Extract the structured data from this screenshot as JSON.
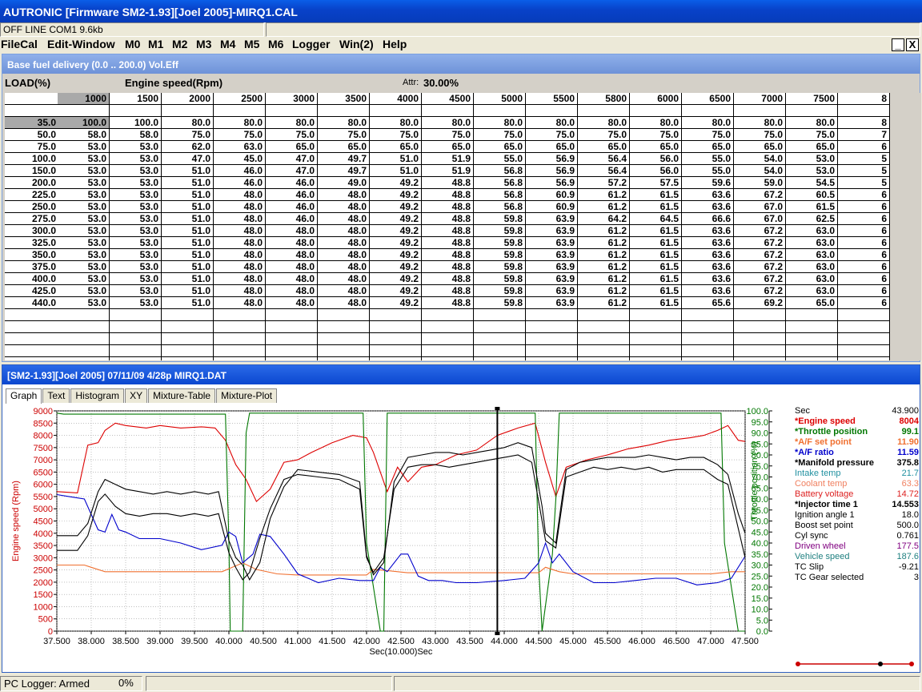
{
  "window": {
    "title": "AUTRONIC [Firmware SM2-1.93][Joel 2005]-MIRQ1.CAL"
  },
  "status_top": {
    "connection": "OFF LINE COM1 9.6kb"
  },
  "menu": [
    "FileCal",
    "Edit-Window",
    "M0",
    "M1",
    "M2",
    "M3",
    "M4",
    "M5",
    "M6",
    "Logger",
    "Win(2)",
    "Help"
  ],
  "mdi_buttons": {
    "minimize": "_",
    "close": "X"
  },
  "fuel_table": {
    "title": "Base fuel delivery (0.0 .. 200.0) Vol.Eff",
    "load_label": "LOAD(%)",
    "rpm_label": "Engine speed(Rpm)",
    "attr": "Attr:",
    "attr_value": "30.00%",
    "rpm": [
      "1000",
      "1500",
      "2000",
      "2500",
      "3000",
      "3500",
      "4000",
      "4500",
      "5000",
      "5500",
      "5800",
      "6000",
      "6500",
      "7000",
      "7500",
      "8"
    ],
    "loads": [
      "35.0",
      "50.0",
      "75.0",
      "100.0",
      "150.0",
      "200.0",
      "225.0",
      "250.0",
      "275.0",
      "300.0",
      "325.0",
      "350.0",
      "375.0",
      "400.0",
      "425.0",
      "440.0"
    ],
    "cells": [
      [
        "100.0",
        "100.0",
        "80.0",
        "80.0",
        "80.0",
        "80.0",
        "80.0",
        "80.0",
        "80.0",
        "80.0",
        "80.0",
        "80.0",
        "80.0",
        "80.0",
        "80.0",
        "8"
      ],
      [
        "58.0",
        "58.0",
        "75.0",
        "75.0",
        "75.0",
        "75.0",
        "75.0",
        "75.0",
        "75.0",
        "75.0",
        "75.0",
        "75.0",
        "75.0",
        "75.0",
        "75.0",
        "7"
      ],
      [
        "53.0",
        "53.0",
        "62.0",
        "63.0",
        "65.0",
        "65.0",
        "65.0",
        "65.0",
        "65.0",
        "65.0",
        "65.0",
        "65.0",
        "65.0",
        "65.0",
        "65.0",
        "6"
      ],
      [
        "53.0",
        "53.0",
        "47.0",
        "45.0",
        "47.0",
        "49.7",
        "51.0",
        "51.9",
        "55.0",
        "56.9",
        "56.4",
        "56.0",
        "55.0",
        "54.0",
        "53.0",
        "5"
      ],
      [
        "53.0",
        "53.0",
        "51.0",
        "46.0",
        "47.0",
        "49.7",
        "51.0",
        "51.9",
        "56.8",
        "56.9",
        "56.4",
        "56.0",
        "55.0",
        "54.0",
        "53.0",
        "5"
      ],
      [
        "53.0",
        "53.0",
        "51.0",
        "46.0",
        "46.0",
        "49.0",
        "49.2",
        "48.8",
        "56.8",
        "56.9",
        "57.2",
        "57.5",
        "59.6",
        "59.0",
        "54.5",
        "5"
      ],
      [
        "53.0",
        "53.0",
        "51.0",
        "48.0",
        "46.0",
        "48.0",
        "49.2",
        "48.8",
        "56.8",
        "60.9",
        "61.2",
        "61.5",
        "63.6",
        "67.2",
        "60.5",
        "6"
      ],
      [
        "53.0",
        "53.0",
        "51.0",
        "48.0",
        "46.0",
        "48.0",
        "49.2",
        "48.8",
        "56.8",
        "60.9",
        "61.2",
        "61.5",
        "63.6",
        "67.0",
        "61.5",
        "6"
      ],
      [
        "53.0",
        "53.0",
        "51.0",
        "48.0",
        "46.0",
        "48.0",
        "49.2",
        "48.8",
        "59.8",
        "63.9",
        "64.2",
        "64.5",
        "66.6",
        "67.0",
        "62.5",
        "6"
      ],
      [
        "53.0",
        "53.0",
        "51.0",
        "48.0",
        "48.0",
        "48.0",
        "49.2",
        "48.8",
        "59.8",
        "63.9",
        "61.2",
        "61.5",
        "63.6",
        "67.2",
        "63.0",
        "6"
      ],
      [
        "53.0",
        "53.0",
        "51.0",
        "48.0",
        "48.0",
        "48.0",
        "49.2",
        "48.8",
        "59.8",
        "63.9",
        "61.2",
        "61.5",
        "63.6",
        "67.2",
        "63.0",
        "6"
      ],
      [
        "53.0",
        "53.0",
        "51.0",
        "48.0",
        "48.0",
        "48.0",
        "49.2",
        "48.8",
        "59.8",
        "63.9",
        "61.2",
        "61.5",
        "63.6",
        "67.2",
        "63.0",
        "6"
      ],
      [
        "53.0",
        "53.0",
        "51.0",
        "48.0",
        "48.0",
        "48.0",
        "49.2",
        "48.8",
        "59.8",
        "63.9",
        "61.2",
        "61.5",
        "63.6",
        "67.2",
        "63.0",
        "6"
      ],
      [
        "53.0",
        "53.0",
        "51.0",
        "48.0",
        "48.0",
        "48.0",
        "49.2",
        "48.8",
        "59.8",
        "63.9",
        "61.2",
        "61.5",
        "63.6",
        "67.2",
        "63.0",
        "6"
      ],
      [
        "53.0",
        "53.0",
        "51.0",
        "48.0",
        "48.0",
        "48.0",
        "49.2",
        "48.8",
        "59.8",
        "63.9",
        "61.2",
        "61.5",
        "63.6",
        "67.2",
        "63.0",
        "6"
      ],
      [
        "53.0",
        "53.0",
        "51.0",
        "48.0",
        "48.0",
        "48.0",
        "49.2",
        "48.8",
        "59.8",
        "63.9",
        "61.2",
        "61.5",
        "65.6",
        "69.2",
        "65.0",
        "6"
      ]
    ]
  },
  "logger": {
    "title": "[SM2-1.93][Joel 2005] 07/11/09 4/28p MIRQ1.DAT",
    "tabs": [
      "Graph",
      "Text",
      "Histogram",
      "XY",
      "Mixture-Table",
      "Mixture-Plot"
    ],
    "active_tab": "Graph",
    "legend": [
      {
        "label": "Sec",
        "value": "43.900",
        "color": "#000000",
        "bold": false
      },
      {
        "label": "*Engine speed",
        "value": "8004",
        "color": "#dd0000",
        "bold": true
      },
      {
        "label": "*Throttle position",
        "value": "99.1",
        "color": "#007700",
        "bold": true
      },
      {
        "label": "*A/F set point",
        "value": "11.90",
        "color": "#f07030",
        "bold": true
      },
      {
        "label": "*A/F ratio",
        "value": "11.59",
        "color": "#0000cc",
        "bold": true
      },
      {
        "label": "*Manifold pressure",
        "value": "375.8",
        "color": "#000000",
        "bold": true
      },
      {
        "label": "Intake temp",
        "value": "21.7",
        "color": "#2090a0",
        "bold": false
      },
      {
        "label": "Coolant temp",
        "value": "63.3",
        "color": "#f08060",
        "bold": false
      },
      {
        "label": "Battery voltage",
        "value": "14.72",
        "color": "#dd2020",
        "bold": false
      },
      {
        "label": "*Injector time 1",
        "value": "14.553",
        "color": "#000000",
        "bold": true
      },
      {
        "label": "Ignition angle 1",
        "value": "18.0",
        "color": "#000000",
        "bold": false
      },
      {
        "label": "Boost set point",
        "value": "500.0",
        "color": "#000000",
        "bold": false
      },
      {
        "label": "Cyl sync",
        "value": "0.761",
        "color": "#000000",
        "bold": false
      },
      {
        "label": "Driven wheel",
        "value": "177.5",
        "color": "#800080",
        "bold": false
      },
      {
        "label": "Vehicle speed",
        "value": "187.6",
        "color": "#208080",
        "bold": false
      },
      {
        "label": "TC Slip",
        "value": "-9.21",
        "color": "#000000",
        "bold": false
      },
      {
        "label": "TC Gear selected",
        "value": "3",
        "color": "#000000",
        "bold": false
      }
    ]
  },
  "chart_data": {
    "type": "line",
    "xlabel": "Sec(10.000)Sec",
    "ylabel": "Engine speed (Rpm)",
    "y2label": "Throttle position (%)",
    "xlim": [
      37.5,
      47.5
    ],
    "ylim": [
      0,
      9000
    ],
    "y2lim": [
      0,
      100
    ],
    "x_ticks": [
      "37.500",
      "38.000",
      "38.500",
      "39.000",
      "39.500",
      "40.000",
      "40.500",
      "41.000",
      "41.500",
      "42.000",
      "42.500",
      "43.000",
      "43.500",
      "44.000",
      "44.500",
      "45.000",
      "45.500",
      "46.000",
      "46.500",
      "47.000",
      "47.500"
    ],
    "y_ticks": [
      "0",
      "500",
      "1000",
      "1500",
      "2000",
      "2500",
      "3000",
      "3500",
      "4000",
      "4500",
      "5000",
      "5500",
      "6000",
      "6500",
      "7000",
      "7500",
      "8000",
      "8500",
      "9000"
    ],
    "y2_ticks": [
      "0.0",
      "5.0",
      "10.0",
      "15.0",
      "20.0",
      "25.0",
      "30.0",
      "35.0",
      "40.0",
      "45.0",
      "50.0",
      "55.0",
      "60.0",
      "65.0",
      "70.0",
      "75.0",
      "80.0",
      "85.0",
      "90.0",
      "95.0",
      "100.0"
    ],
    "cursor_x": 43.9,
    "series": [
      {
        "name": "*Engine speed",
        "color": "#dd0000",
        "axis": "left",
        "x": [
          37.5,
          37.8,
          37.95,
          38.1,
          38.2,
          38.35,
          38.5,
          38.8,
          39.0,
          39.3,
          39.6,
          39.8,
          39.95,
          40.1,
          40.25,
          40.4,
          40.6,
          40.8,
          41.0,
          41.2,
          41.5,
          41.8,
          42.0,
          42.1,
          42.3,
          42.45,
          42.6,
          42.8,
          43.0,
          43.3,
          43.6,
          43.9,
          44.2,
          44.45,
          44.6,
          44.75,
          44.9,
          45.2,
          45.5,
          45.8,
          46.1,
          46.4,
          46.7,
          46.9,
          47.1,
          47.25,
          47.4,
          47.5
        ],
        "y": [
          5700,
          5650,
          7600,
          7700,
          8200,
          8500,
          8400,
          8300,
          8400,
          8300,
          8350,
          8300,
          7800,
          6800,
          6200,
          5300,
          5800,
          6900,
          7000,
          7300,
          7700,
          8000,
          7900,
          7300,
          5700,
          6700,
          6100,
          6700,
          6800,
          7200,
          7400,
          8000,
          8300,
          8500,
          6900,
          5500,
          6700,
          7000,
          7200,
          7450,
          7600,
          7800,
          7900,
          8000,
          8200,
          8400,
          7800,
          7750
        ]
      },
      {
        "name": "*Throttle position",
        "color": "#007700",
        "axis": "right",
        "x": [
          37.5,
          37.6,
          39.95,
          40.0,
          40.02,
          40.2,
          40.25,
          40.3,
          41.95,
          42.0,
          42.2,
          42.25,
          42.3,
          44.45,
          44.5,
          44.55,
          44.7,
          44.75,
          44.8,
          47.15,
          47.2,
          47.4,
          47.5
        ],
        "y": [
          99,
          98.5,
          98.5,
          40,
          0,
          0,
          90,
          99,
          99,
          40,
          0,
          0,
          99,
          99,
          30,
          0,
          35,
          60,
          99,
          99,
          40,
          0,
          0
        ]
      },
      {
        "name": "*A/F set point",
        "color": "#f07030",
        "axis": "right",
        "x": [
          37.5,
          37.9,
          38.0,
          38.2,
          38.5,
          39.0,
          39.5,
          39.9,
          40.05,
          40.2,
          40.4,
          40.7,
          41.0,
          41.5,
          42.0,
          42.1,
          42.3,
          42.6,
          43.0,
          43.5,
          44.0,
          44.5,
          44.6,
          44.8,
          45.0,
          45.5,
          46.0,
          46.5,
          47.0,
          47.3,
          47.5
        ],
        "y": [
          30,
          30,
          29,
          27,
          27,
          27,
          27,
          27,
          29,
          31,
          28,
          26,
          25.5,
          25.5,
          25.5,
          28,
          27.5,
          26.5,
          26.5,
          26.5,
          26.5,
          26.5,
          29,
          27,
          26,
          26,
          26,
          26,
          26,
          27,
          27
        ]
      },
      {
        "name": "*A/F ratio",
        "color": "#0000cc",
        "axis": "right",
        "x": [
          37.5,
          37.7,
          37.9,
          38.1,
          38.2,
          38.3,
          38.4,
          38.5,
          38.7,
          39.0,
          39.3,
          39.6,
          39.9,
          40.0,
          40.1,
          40.2,
          40.35,
          40.45,
          40.6,
          40.8,
          41.0,
          41.3,
          41.6,
          41.9,
          42.1,
          42.2,
          42.3,
          42.5,
          42.6,
          42.75,
          42.9,
          43.1,
          43.3,
          43.6,
          44.0,
          44.3,
          44.5,
          44.6,
          44.7,
          44.8,
          45.0,
          45.3,
          45.6,
          45.9,
          46.2,
          46.5,
          46.8,
          47.1,
          47.3,
          47.5
        ],
        "y": [
          62,
          61,
          60,
          46,
          45,
          53,
          46,
          45,
          42,
          42,
          40,
          37,
          39,
          45,
          43,
          31,
          35,
          44,
          43,
          35,
          26,
          22,
          24,
          23,
          23,
          29,
          27,
          35,
          35,
          25,
          23,
          23,
          22,
          22,
          23,
          24,
          31,
          40,
          31,
          35,
          27,
          22,
          22,
          23,
          24,
          24,
          21,
          22,
          24,
          34
        ]
      },
      {
        "name": "*Manifold pressure upper",
        "color": "#000000",
        "axis": "left",
        "x": [
          37.5,
          37.8,
          37.95,
          38.1,
          38.2,
          38.35,
          38.5,
          38.7,
          38.9,
          39.1,
          39.3,
          39.5,
          39.7,
          39.85,
          40.0,
          40.1,
          40.2,
          40.3,
          40.45,
          40.6,
          40.8,
          41.0,
          41.3,
          41.6,
          41.9,
          42.0,
          42.1,
          42.25,
          42.4,
          42.6,
          42.8,
          43.0,
          43.2,
          43.4,
          43.6,
          43.8,
          44.0,
          44.2,
          44.4,
          44.55,
          44.6,
          44.75,
          44.9,
          45.1,
          45.3,
          45.5,
          45.7,
          45.9,
          46.1,
          46.3,
          46.5,
          46.7,
          46.9,
          47.1,
          47.25,
          47.4,
          47.5
        ],
        "y": [
          3900,
          3900,
          4400,
          5700,
          6200,
          6000,
          5800,
          5700,
          5600,
          5700,
          5600,
          5700,
          5600,
          5700,
          3700,
          3000,
          2700,
          2100,
          2800,
          4600,
          5900,
          6600,
          6500,
          6400,
          6100,
          3100,
          2300,
          2800,
          6100,
          7100,
          7200,
          7300,
          7300,
          7200,
          7300,
          7400,
          7500,
          7700,
          7500,
          5100,
          4000,
          3600,
          6600,
          6900,
          7000,
          7100,
          7100,
          7100,
          7200,
          7100,
          7000,
          7100,
          7100,
          6800,
          6400,
          4800,
          4000
        ]
      },
      {
        "name": "*Manifold pressure lower",
        "color": "#000000",
        "axis": "left",
        "x": [
          37.5,
          37.8,
          37.95,
          38.1,
          38.2,
          38.35,
          38.5,
          38.7,
          38.9,
          39.1,
          39.3,
          39.5,
          39.7,
          39.85,
          40.0,
          40.1,
          40.2,
          40.3,
          40.45,
          40.6,
          40.8,
          41.0,
          41.3,
          41.6,
          41.9,
          42.0,
          42.1,
          42.25,
          42.4,
          42.6,
          42.8,
          43.0,
          43.2,
          43.4,
          43.6,
          43.8,
          44.0,
          44.2,
          44.4,
          44.55,
          44.6,
          44.75,
          44.9,
          45.1,
          45.3,
          45.5,
          45.7,
          45.9,
          46.1,
          46.3,
          46.5,
          46.7,
          46.9,
          47.1,
          47.25,
          47.4,
          47.5
        ],
        "y": [
          3300,
          3300,
          3900,
          5300,
          5600,
          5100,
          4800,
          4700,
          4800,
          4800,
          4700,
          4800,
          4700,
          4800,
          3200,
          2600,
          2100,
          2400,
          3800,
          5000,
          6200,
          6400,
          6300,
          6200,
          5800,
          3000,
          2400,
          3000,
          5800,
          6700,
          6800,
          6800,
          6700,
          6800,
          6900,
          7000,
          7100,
          7200,
          6900,
          4500,
          3700,
          3400,
          6300,
          6500,
          6700,
          6600,
          6700,
          6600,
          6700,
          6500,
          6600,
          6600,
          6600,
          6200,
          6000,
          4200,
          3000
        ]
      }
    ]
  },
  "bottom_status": {
    "logger": "PC Logger: Armed",
    "percent": "0%"
  }
}
